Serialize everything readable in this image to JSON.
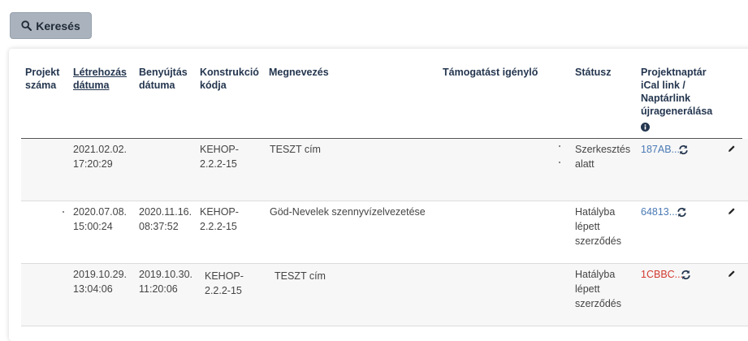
{
  "search": {
    "label": "Keresés"
  },
  "table": {
    "headers": {
      "projekt_szama": [
        "Projekt",
        "száma"
      ],
      "letrehozas": [
        "Létrehozás",
        "dátuma"
      ],
      "benyujtas": [
        "Benyújtás",
        "dátuma"
      ],
      "konstrukcio": [
        "Konstrukció",
        "kódja"
      ],
      "megnevezes": "Megnevezés",
      "tamogatast": "Támogatást igénylő",
      "status": "Státusz",
      "naptar": [
        "Projektnaptár",
        "iCal link /",
        "Naptárlink",
        "újragenerálása"
      ]
    },
    "rows": [
      {
        "letrehozas": [
          "2021.02.02.",
          "17:20:29"
        ],
        "benyujtas": [
          "",
          ""
        ],
        "konstrukcio": [
          "KEHOP-",
          "2.2.2-15"
        ],
        "megnevezes": "TESZT cím",
        "status": [
          "Szerkesztés",
          "alatt",
          ""
        ],
        "ical": "187AB..."
      },
      {
        "letrehozas": [
          "2020.07.08.",
          "15:00:24"
        ],
        "benyujtas": [
          "2020.11.16.",
          "08:37:52"
        ],
        "konstrukcio": [
          "KEHOP-",
          "2.2.2-15"
        ],
        "megnevezes": "Göd-Nevelek szennyvízelvezetése",
        "status": [
          "Hatályba",
          "lépett",
          "szerződés"
        ],
        "ical": "64813..."
      },
      {
        "letrehozas": [
          "2019.10.29.",
          "13:04:06"
        ],
        "benyujtas": [
          "2019.10.30.",
          "11:20:06"
        ],
        "konstrukcio": [
          "KEHOP-",
          "2.2.2-15"
        ],
        "megnevezes": "TESZT cím",
        "status": [
          "Hatályba",
          "lépett",
          "szerződés"
        ],
        "ical": "1CBBC..."
      }
    ]
  },
  "colors": {
    "link": "#4a7ab5",
    "link_alert": "#d23a2e",
    "header": "#24364f",
    "button": "#a9b2bd"
  }
}
